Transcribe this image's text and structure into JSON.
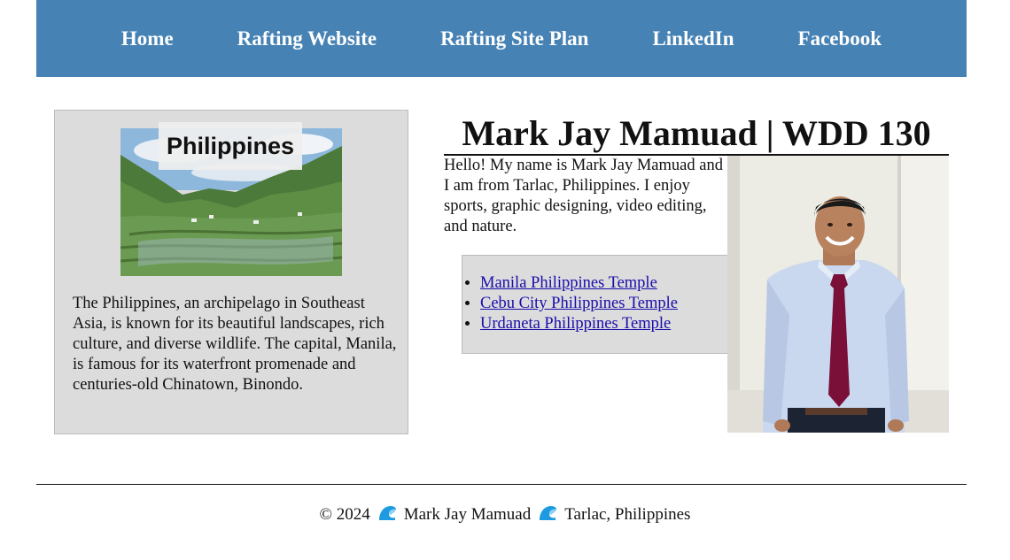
{
  "nav": {
    "items": [
      {
        "label": "Home"
      },
      {
        "label": "Rafting Website"
      },
      {
        "label": "Rafting Site Plan"
      },
      {
        "label": "LinkedIn"
      },
      {
        "label": "Facebook"
      }
    ]
  },
  "aside": {
    "image_caption": "Philippines",
    "text": "The Philippines, an archipelago in Southeast Asia, is known for its beautiful landscapes, rich culture, and diverse wildlife. The capital, Manila, is famous for its waterfront promenade and centuries-old Chinatown, Binondo."
  },
  "main": {
    "title": "Mark Jay Mamuad | WDD 130",
    "intro": "Hello! My name is Mark Jay Mamuad and I am from Tarlac, Philippines. I enjoy sports, graphic designing, video editing, and nature.",
    "links": [
      {
        "label": "Manila Philippines Temple"
      },
      {
        "label": "Cebu City Philippines Temple"
      },
      {
        "label": "Urdaneta Philippines Temple"
      }
    ]
  },
  "footer": {
    "copyright": "© 2024",
    "name": "Mark Jay Mamuad",
    "location": "Tarlac, Philippines",
    "separator_icon": "wave-icon"
  },
  "colors": {
    "nav_bg": "#4682b4",
    "panel_bg": "#dcdcdc",
    "link": "#1a0dab"
  }
}
